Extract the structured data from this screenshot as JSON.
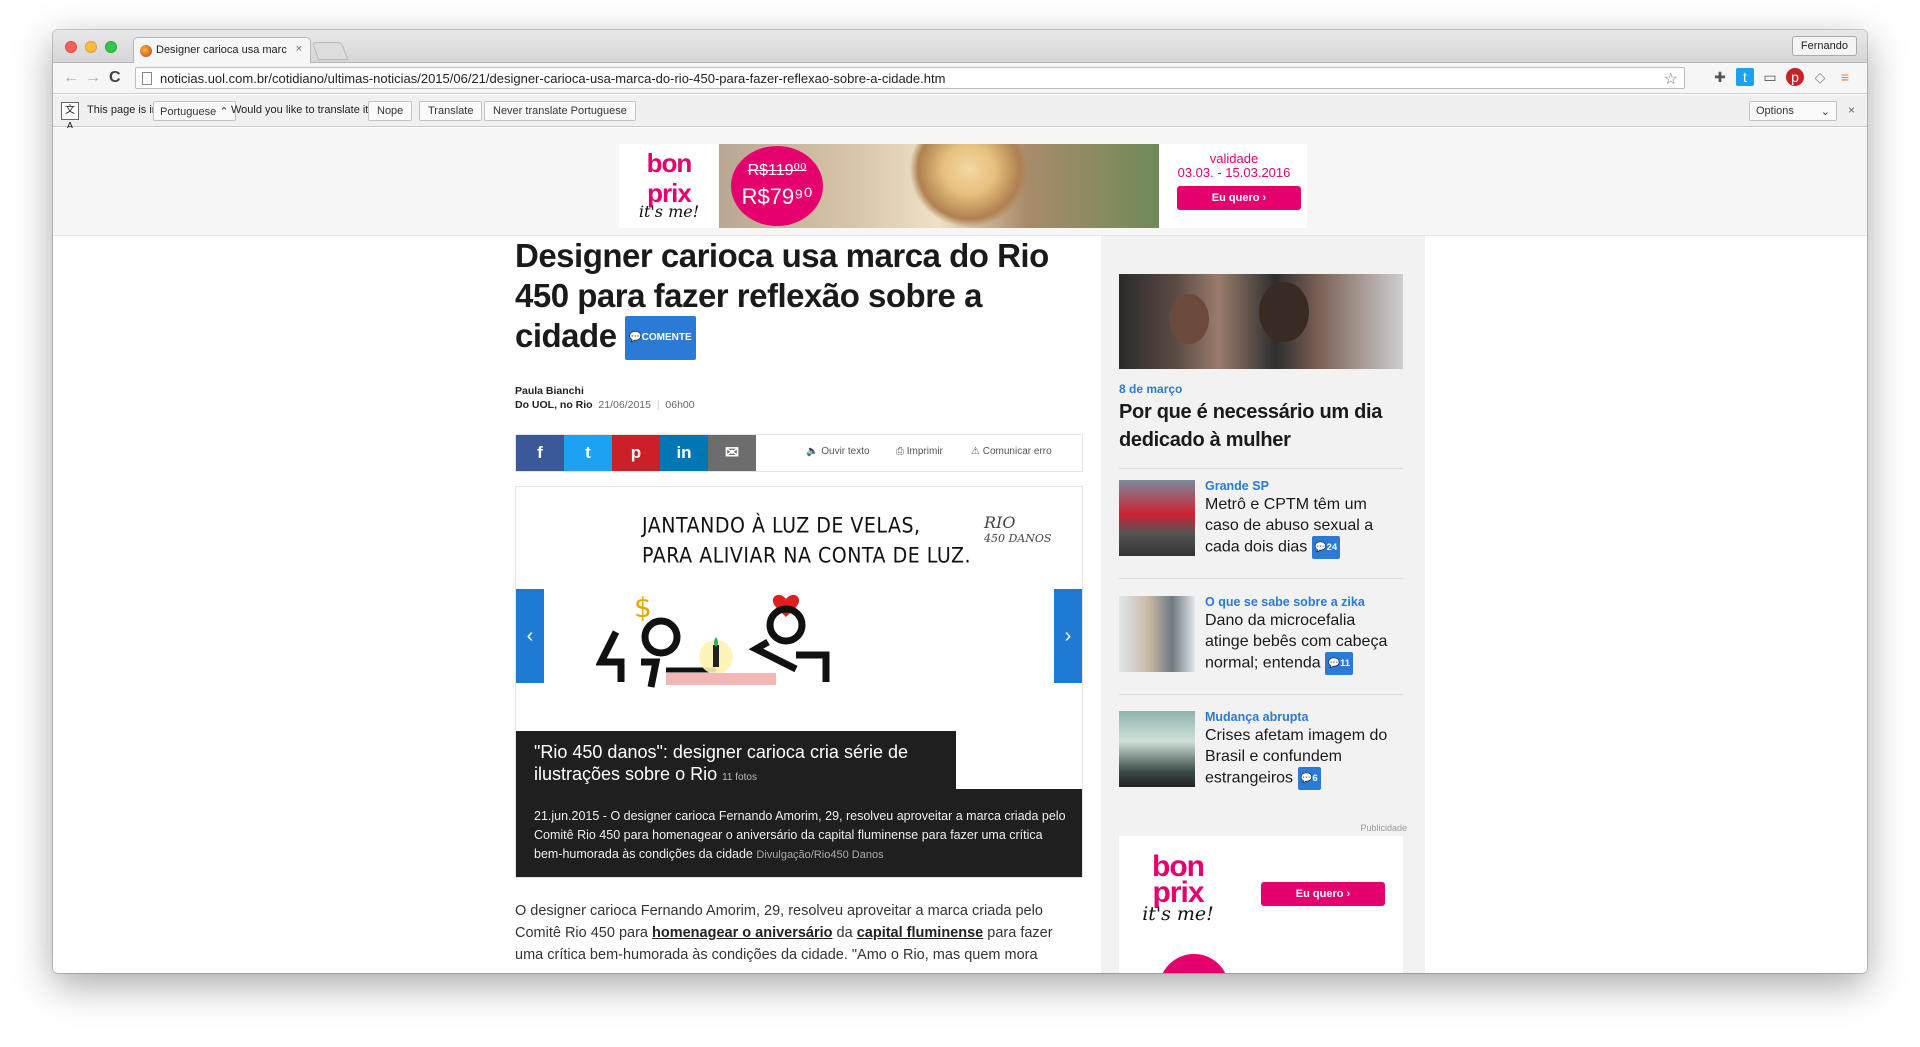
{
  "browser": {
    "tab_title": "Designer carioca usa marc",
    "tab_close": "×",
    "profile_name": "Fernando",
    "url": "noticias.uol.com.br/cotidiano/ultimas-noticias/2015/06/21/designer-carioca-usa-marca-do-rio-450-para-fazer-reflexao-sobre-a-cidade.htm",
    "nav_back": "←",
    "nav_forward": "→",
    "nav_reload": "C"
  },
  "translate_bar": {
    "page_is_in": "This page is in",
    "language": "Portuguese",
    "question": "Would you like to translate it?",
    "nope": "Nope",
    "translate": "Translate",
    "never": "Never translate Portuguese",
    "options": "Options",
    "close": "×"
  },
  "top_ad": {
    "logo_top": "bon",
    "logo_mid": "prix",
    "logo_tag": "it's me!",
    "old_price": "R$119⁰⁰",
    "new_price": "R$79⁹⁰",
    "validity_label": "validade",
    "validity_dates": "03.03. - 15.03.2016",
    "button": "Eu quero"
  },
  "article": {
    "headline": "Designer carioca usa marca do Rio 450 para fazer reflexão sobre a cidade",
    "comente": "COMENTE",
    "author": "Paula Bianchi",
    "source": "Do UOL, no Rio",
    "date": "21/06/2015",
    "time": "06h00",
    "share": {
      "facebook": "f",
      "twitter": "t",
      "pinterest": "p",
      "linkedin": "in",
      "email": "✉"
    },
    "tools": {
      "listen": "Ouvir texto",
      "print": "Imprimir",
      "report": "Comunicar erro"
    },
    "gallery": {
      "illustration_line1": "JANTANDO À LUZ DE VELAS,",
      "illustration_line2": "PARA ALIVIAR NA CONTA DE LUZ.",
      "illustration_brand_top": "RIO",
      "illustration_brand_bottom": "450 DANOS",
      "caption_title": "\"Rio 450 danos\": designer carioca cria série de ilustrações sobre o Rio",
      "photo_count": "11 fotos",
      "description": "21.jun.2015 - O designer carioca Fernando Amorim, 29, resolveu aproveitar a marca criada pelo Comitê Rio 450 para homenagear o aniversário da capital fluminense para fazer uma crítica bem-humorada às condições da cidade",
      "credit": "Divulgação/Rio450 Danos"
    },
    "body": {
      "p1_part1": "O designer carioca Fernando Amorim, 29, resolveu aproveitar a marca criada pelo Comitê Rio 450 para ",
      "link1": "homenagear o aniversário",
      "p1_part2": " da ",
      "link2": "capital fluminense",
      "p1_part3": " para fazer uma crítica bem-humorada às condições da cidade. \"Amo o Rio, mas quem mora"
    }
  },
  "sidebar": {
    "featured": {
      "kicker": "8 de março",
      "title": "Por que é necessário um dia dedicado à mulher"
    },
    "items": [
      {
        "kicker": "Grande SP",
        "title": "Metrô e CPTM têm um caso de abuso sexual a cada dois dias",
        "comments": "24"
      },
      {
        "kicker": "O que se sabe sobre a zika",
        "title": "Dano da microcefalia atinge bebês com cabeça normal; entenda",
        "comments": "11"
      },
      {
        "kicker": "Mudança abrupta",
        "title": "Crises afetam imagem do Brasil e confundem estrangeiros",
        "comments": "6"
      }
    ],
    "ad_label": "Publicidade",
    "ad": {
      "logo_top": "bon",
      "logo_mid": "prix",
      "logo_tag": "it's me!",
      "button": "Eu quero"
    }
  },
  "colors": {
    "brand_pink": "#e6006d",
    "uol_blue": "#2a7ad6",
    "facebook": "#3b5998",
    "twitter": "#1da1f2",
    "pinterest": "#cb2027",
    "linkedin": "#0077b5"
  }
}
